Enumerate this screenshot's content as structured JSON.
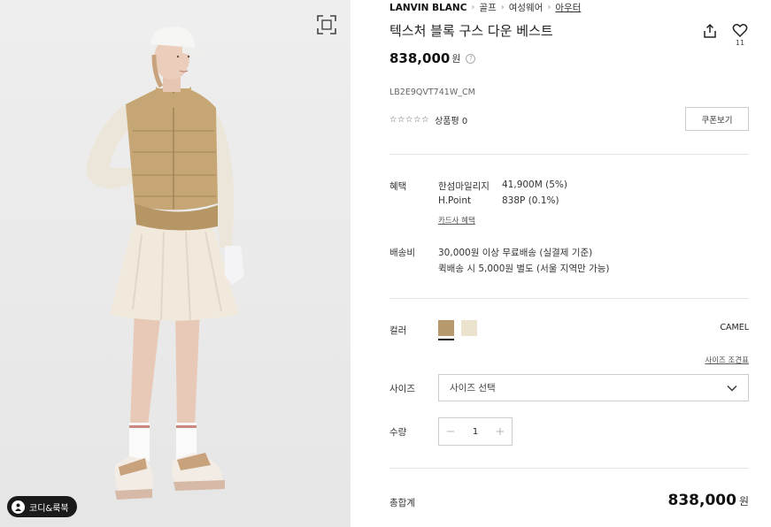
{
  "breadcrumb": {
    "brand": "LANVIN BLANC",
    "items": [
      "골프",
      "여성웨어"
    ],
    "current": "아우터"
  },
  "product": {
    "title": "텍스처 블록 구스 다운 베스트",
    "price": "838,000",
    "currency": "원",
    "sku": "LB2E9QVT741W_CM",
    "stars": "☆☆☆☆☆",
    "review_label": "상품평 0",
    "coupon_button": "쿠폰보기",
    "like_count": "11"
  },
  "benefits": {
    "label": "혜택",
    "rows": [
      {
        "name": "한섬마일리지",
        "value": "41,900M (5%)"
      },
      {
        "name": "H.Point",
        "value": "838P (0.1%)"
      }
    ],
    "card_link": "카드사 혜택"
  },
  "shipping": {
    "label": "배송비",
    "lines": [
      "30,000원 이상 무료배송 (실결제 기준)",
      "퀵배송 시 5,000원 별도 (서울 지역만 가능)"
    ]
  },
  "options": {
    "color_label": "컬러",
    "colors": [
      {
        "name": "camel",
        "hex": "#b79a6b",
        "selected": true
      },
      {
        "name": "ivory",
        "hex": "#ece3cf",
        "selected": false
      }
    ],
    "selected_color_name": "CAMEL",
    "size_guide_link": "사이즈 조견표",
    "size_label": "사이즈",
    "size_placeholder": "사이즈 선택",
    "qty_label": "수량",
    "qty_value": "1",
    "qty_minus": "−",
    "qty_plus": "+"
  },
  "total": {
    "label": "총합계",
    "price": "838,000",
    "currency": "원"
  },
  "image_panel": {
    "coordi_button": "코디&룩북"
  },
  "icons": {
    "zoom": "expand-frame-icon",
    "share": "share-icon",
    "like": "heart-icon",
    "help": "question-circle-icon",
    "dropdown": "chevron-down-icon",
    "coordi": "person-icon"
  }
}
